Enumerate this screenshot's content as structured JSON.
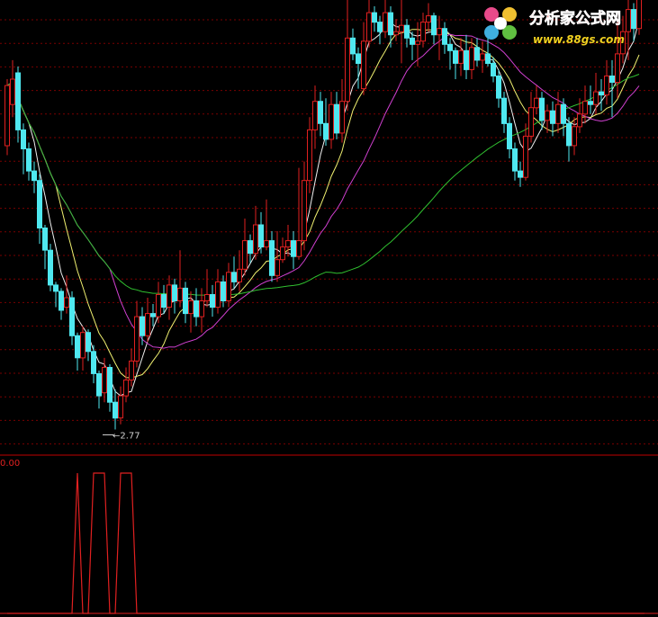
{
  "watermark": {
    "site_name": "分析家公式网",
    "site_url": "www.88gs.com"
  },
  "colors": {
    "background": "#000000",
    "up": "#e02020",
    "down": "#4fe8f0",
    "grid": "#7a0000",
    "separator": "#c00000",
    "ma5": "#f0f0f0",
    "ma10": "#f0f070",
    "ma20": "#d040d0",
    "ma60": "#30c030",
    "indicator": "#e02020",
    "label": "#d0d0d0",
    "label_red": "#e02020"
  },
  "main_panel": {
    "price_range": [
      2.45,
      9.55
    ],
    "low_label": "2.77",
    "low_index": 20
  },
  "indicator_panel": {
    "top_value_label": "0.00"
  },
  "chart_data": {
    "type": "candlestick",
    "candles": [
      [
        7.25,
        8.2,
        8.3,
        7.1
      ],
      [
        7.9,
        8.3,
        8.6,
        7.7
      ],
      [
        8.4,
        7.5,
        8.5,
        7.3
      ],
      [
        7.5,
        7.2,
        7.6,
        6.8
      ],
      [
        7.2,
        6.85,
        7.3,
        6.7
      ],
      [
        6.85,
        6.7,
        7.0,
        6.5
      ],
      [
        6.7,
        5.95,
        6.8,
        5.7
      ],
      [
        5.95,
        5.6,
        6.0,
        5.3
      ],
      [
        5.6,
        5.05,
        5.7,
        4.95
      ],
      [
        5.05,
        4.95,
        5.1,
        4.7
      ],
      [
        4.95,
        4.65,
        5.0,
        4.5
      ],
      [
        4.7,
        4.85,
        5.2,
        4.6
      ],
      [
        4.85,
        4.25,
        4.95,
        4.1
      ],
      [
        4.25,
        3.9,
        4.3,
        3.7
      ],
      [
        3.9,
        4.3,
        4.4,
        3.7
      ],
      [
        4.3,
        4.0,
        4.35,
        3.85
      ],
      [
        4.0,
        3.65,
        4.1,
        3.5
      ],
      [
        3.65,
        3.3,
        3.7,
        3.1
      ],
      [
        3.35,
        3.75,
        3.9,
        3.2
      ],
      [
        3.75,
        3.2,
        3.8,
        3.05
      ],
      [
        3.2,
        2.95,
        3.4,
        2.77
      ],
      [
        2.95,
        3.3,
        3.45,
        2.85
      ],
      [
        3.3,
        3.55,
        3.75,
        3.2
      ],
      [
        3.55,
        3.85,
        4.05,
        3.45
      ],
      [
        3.85,
        4.55,
        4.8,
        3.75
      ],
      [
        4.55,
        4.25,
        4.7,
        4.1
      ],
      [
        4.25,
        4.6,
        4.85,
        4.15
      ],
      [
        4.6,
        4.55,
        4.75,
        4.4
      ],
      [
        4.55,
        4.9,
        5.1,
        4.45
      ],
      [
        4.9,
        4.7,
        5.05,
        4.6
      ],
      [
        4.7,
        5.05,
        5.2,
        4.5
      ],
      [
        5.05,
        4.8,
        5.15,
        4.6
      ],
      [
        4.8,
        5.0,
        5.6,
        4.7
      ],
      [
        5.0,
        4.6,
        5.1,
        4.45
      ],
      [
        4.6,
        4.8,
        4.95,
        4.3
      ],
      [
        4.8,
        4.55,
        5.0,
        4.4
      ],
      [
        4.55,
        4.8,
        5.0,
        4.3
      ],
      [
        4.8,
        4.9,
        5.3,
        4.7
      ],
      [
        4.9,
        4.7,
        5.05,
        4.55
      ],
      [
        4.7,
        5.1,
        5.3,
        4.6
      ],
      [
        5.1,
        4.8,
        5.2,
        4.7
      ],
      [
        4.8,
        5.25,
        5.4,
        4.7
      ],
      [
        5.25,
        5.1,
        5.5,
        5.0
      ],
      [
        5.1,
        5.3,
        5.6,
        4.95
      ],
      [
        5.3,
        5.75,
        6.1,
        5.2
      ],
      [
        5.75,
        5.55,
        5.85,
        5.4
      ],
      [
        5.55,
        6.0,
        6.3,
        5.45
      ],
      [
        6.0,
        5.65,
        6.2,
        5.55
      ],
      [
        5.65,
        5.75,
        6.4,
        5.6
      ],
      [
        5.75,
        5.2,
        5.9,
        5.1
      ],
      [
        5.2,
        5.45,
        5.9,
        5.1
      ],
      [
        5.45,
        5.65,
        5.8,
        5.4
      ],
      [
        5.65,
        5.75,
        6.0,
        5.5
      ],
      [
        5.75,
        5.5,
        5.9,
        5.3
      ],
      [
        5.5,
        5.75,
        6.9,
        5.45
      ],
      [
        5.75,
        6.7,
        7.0,
        5.6
      ],
      [
        6.7,
        7.5,
        7.7,
        6.5
      ],
      [
        7.5,
        7.95,
        8.2,
        7.2
      ],
      [
        7.95,
        7.6,
        8.1,
        7.4
      ],
      [
        7.6,
        7.35,
        8.0,
        7.25
      ],
      [
        7.35,
        7.9,
        8.1,
        7.2
      ],
      [
        7.9,
        7.45,
        8.1,
        7.35
      ],
      [
        7.45,
        7.95,
        8.3,
        7.3
      ],
      [
        7.95,
        8.95,
        9.55,
        7.8
      ],
      [
        8.95,
        8.7,
        9.1,
        8.6
      ],
      [
        8.7,
        8.55,
        8.8,
        8.15
      ],
      [
        8.15,
        8.9,
        9.2,
        8.05
      ],
      [
        8.9,
        9.35,
        9.55,
        8.8
      ],
      [
        9.35,
        9.2,
        9.45,
        9.05
      ],
      [
        9.2,
        9.05,
        9.3,
        8.85
      ],
      [
        9.05,
        9.35,
        9.55,
        8.95
      ],
      [
        9.35,
        9.0,
        9.45,
        8.8
      ],
      [
        9.0,
        9.05,
        9.25,
        8.9
      ],
      [
        9.05,
        9.15,
        9.55,
        8.55
      ],
      [
        9.15,
        8.95,
        9.25,
        8.8
      ],
      [
        8.95,
        8.85,
        9.05,
        8.6
      ],
      [
        8.85,
        8.9,
        9.2,
        8.5
      ],
      [
        8.9,
        9.2,
        9.35,
        8.8
      ],
      [
        9.2,
        9.3,
        9.5,
        9.05
      ],
      [
        9.3,
        9.0,
        9.35,
        8.85
      ],
      [
        9.0,
        9.1,
        9.3,
        8.6
      ],
      [
        9.1,
        8.85,
        9.2,
        8.7
      ],
      [
        8.85,
        8.75,
        8.95,
        8.45
      ],
      [
        8.75,
        8.55,
        8.8,
        8.3
      ],
      [
        8.55,
        8.75,
        8.95,
        8.35
      ],
      [
        8.75,
        8.45,
        9.0,
        8.3
      ],
      [
        8.45,
        8.8,
        8.95,
        8.3
      ],
      [
        8.8,
        8.6,
        8.95,
        8.5
      ],
      [
        8.6,
        8.7,
        8.9,
        8.4
      ],
      [
        8.7,
        8.55,
        9.0,
        8.5
      ],
      [
        8.55,
        8.35,
        8.65,
        8.25
      ],
      [
        8.35,
        8.0,
        8.45,
        7.85
      ],
      [
        8.0,
        7.6,
        8.1,
        7.45
      ],
      [
        7.6,
        7.2,
        7.7,
        7.05
      ],
      [
        7.2,
        6.85,
        7.3,
        6.7
      ],
      [
        6.85,
        6.75,
        7.0,
        6.6
      ],
      [
        6.75,
        7.4,
        7.6,
        6.7
      ],
      [
        7.4,
        7.85,
        8.1,
        7.3
      ],
      [
        7.85,
        8.0,
        8.2,
        7.75
      ],
      [
        8.0,
        7.65,
        8.1,
        7.5
      ],
      [
        7.65,
        7.8,
        7.9,
        7.45
      ],
      [
        7.8,
        7.6,
        7.95,
        7.4
      ],
      [
        7.6,
        7.9,
        8.1,
        7.45
      ],
      [
        7.9,
        7.6,
        8.0,
        7.4
      ],
      [
        7.6,
        7.25,
        7.7,
        7.0
      ],
      [
        7.25,
        7.55,
        7.7,
        7.1
      ],
      [
        7.55,
        7.75,
        8.0,
        7.45
      ],
      [
        7.75,
        7.95,
        8.2,
        7.6
      ],
      [
        7.95,
        7.9,
        8.2,
        7.75
      ],
      [
        7.9,
        8.1,
        8.4,
        7.75
      ],
      [
        8.1,
        8.05,
        8.3,
        7.8
      ],
      [
        8.05,
        8.35,
        8.6,
        7.9
      ],
      [
        8.35,
        8.25,
        8.6,
        7.7
      ],
      [
        8.25,
        8.7,
        9.2,
        8.0
      ],
      [
        8.7,
        9.05,
        9.3,
        8.55
      ],
      [
        9.05,
        9.4,
        9.6,
        8.6
      ],
      [
        9.4,
        9.1,
        9.5,
        8.9
      ],
      [
        9.1,
        9.95,
        10.1,
        9.0
      ]
    ],
    "indicator": {
      "values": [
        0,
        0,
        0,
        0,
        0,
        0,
        0,
        0,
        0,
        0,
        0,
        0,
        0,
        1,
        0,
        0,
        1,
        1,
        1,
        0,
        0,
        1,
        1,
        1,
        0,
        0,
        0,
        0,
        0,
        0,
        0,
        0,
        0,
        0,
        0,
        0,
        0,
        0,
        0,
        0,
        0,
        0,
        0,
        0,
        0,
        0,
        0,
        0,
        0,
        0,
        0,
        0,
        0,
        0,
        0,
        0,
        0,
        0,
        0,
        0,
        0,
        0,
        0,
        0,
        0,
        0,
        0,
        0,
        0,
        0,
        0,
        0,
        0,
        0,
        0,
        0,
        0,
        0,
        0,
        0,
        0,
        0,
        0,
        0,
        0,
        0,
        0,
        0,
        0,
        0,
        0,
        0,
        0,
        0,
        0,
        0,
        0,
        0,
        0,
        0,
        0,
        0,
        0,
        0,
        0,
        0,
        0,
        0,
        0,
        0,
        0,
        0,
        0,
        0,
        0,
        0,
        0,
        0,
        0
      ],
      "range": [
        0,
        1
      ]
    }
  }
}
